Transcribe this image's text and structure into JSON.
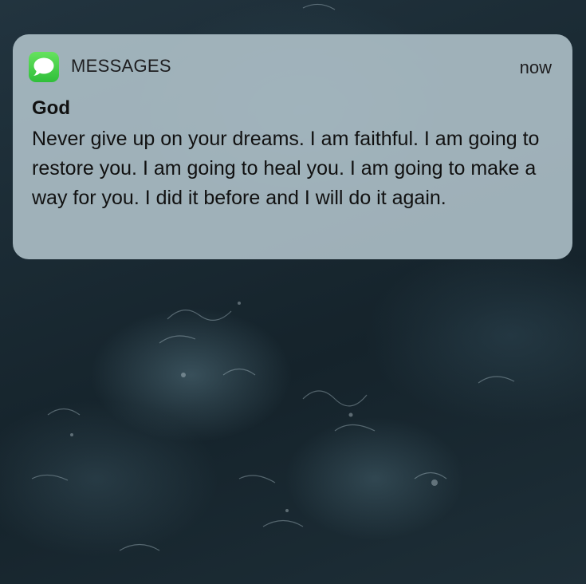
{
  "notification": {
    "app_name": "MESSAGES",
    "app_icon": "messages-bubble-icon",
    "timestamp": "now",
    "sender": "God",
    "message": "Never give up on your dreams. I am faithful. I am going to restore you. I am going to heal you. I am going to make a way for you. I did it before and I will do it again."
  },
  "colors": {
    "icon_green": "#3ccf45",
    "card_background": "#b2c4cc",
    "text": "#111111"
  }
}
